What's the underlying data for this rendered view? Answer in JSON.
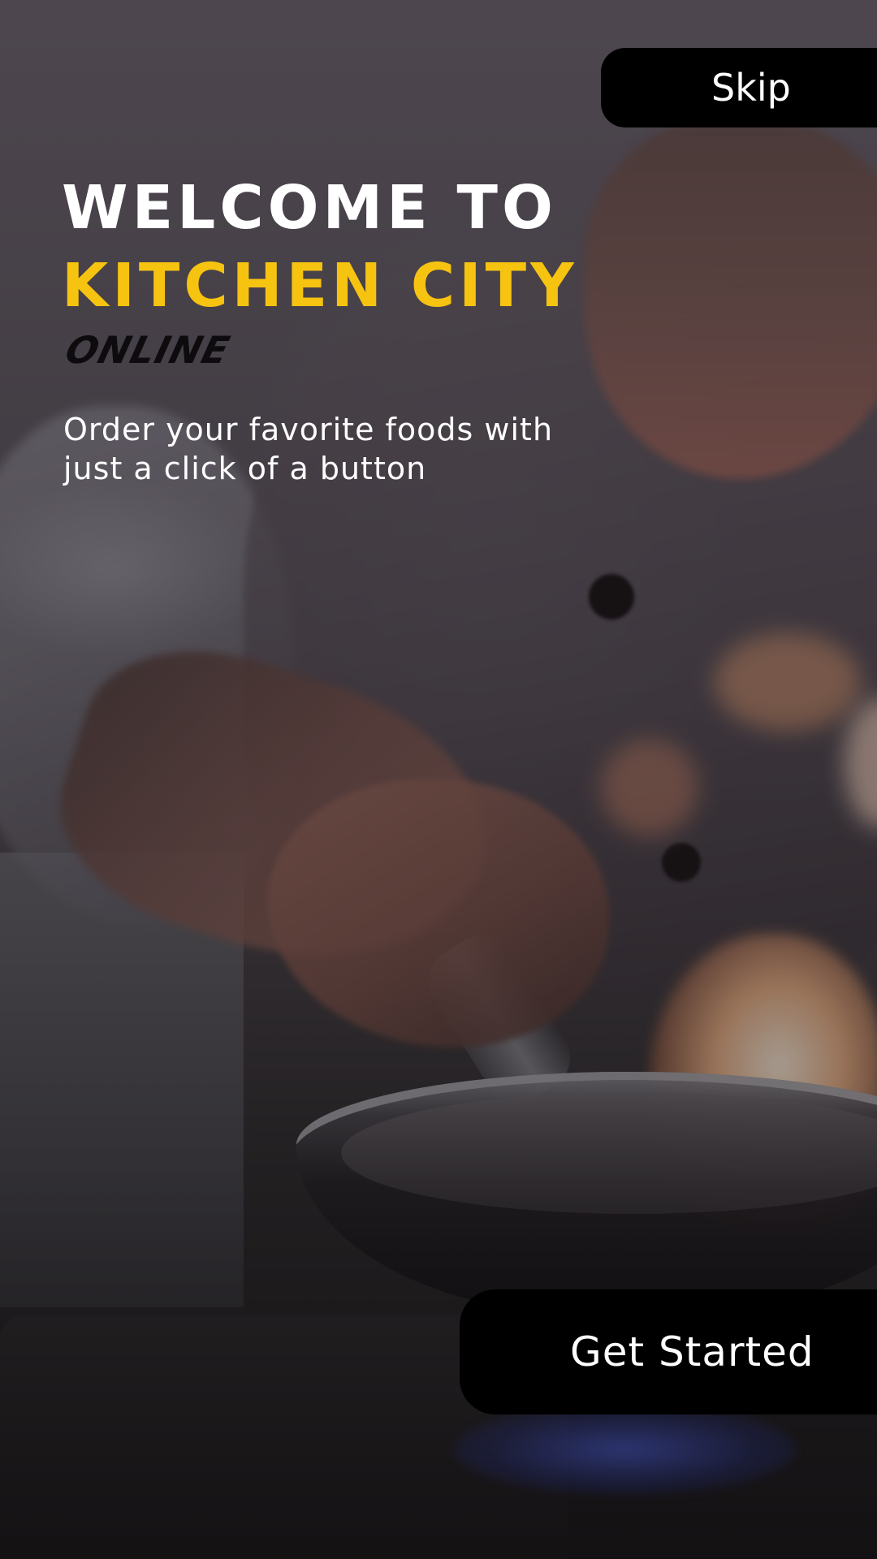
{
  "skip_label": "Skip",
  "headline": {
    "line1": "WELCOME TO",
    "line2": "KITCHEN CITY"
  },
  "tagline": "ONLINE",
  "subtitle": {
    "line1": "Order your favorite foods with",
    "line2": "just a click of a button"
  },
  "cta_label": "Get Started",
  "colors": {
    "accent_yellow": "#f6c311",
    "button_bg": "#000000",
    "text_light": "#ffffff"
  },
  "background_image": "chef-cooking-with-flaming-pan"
}
